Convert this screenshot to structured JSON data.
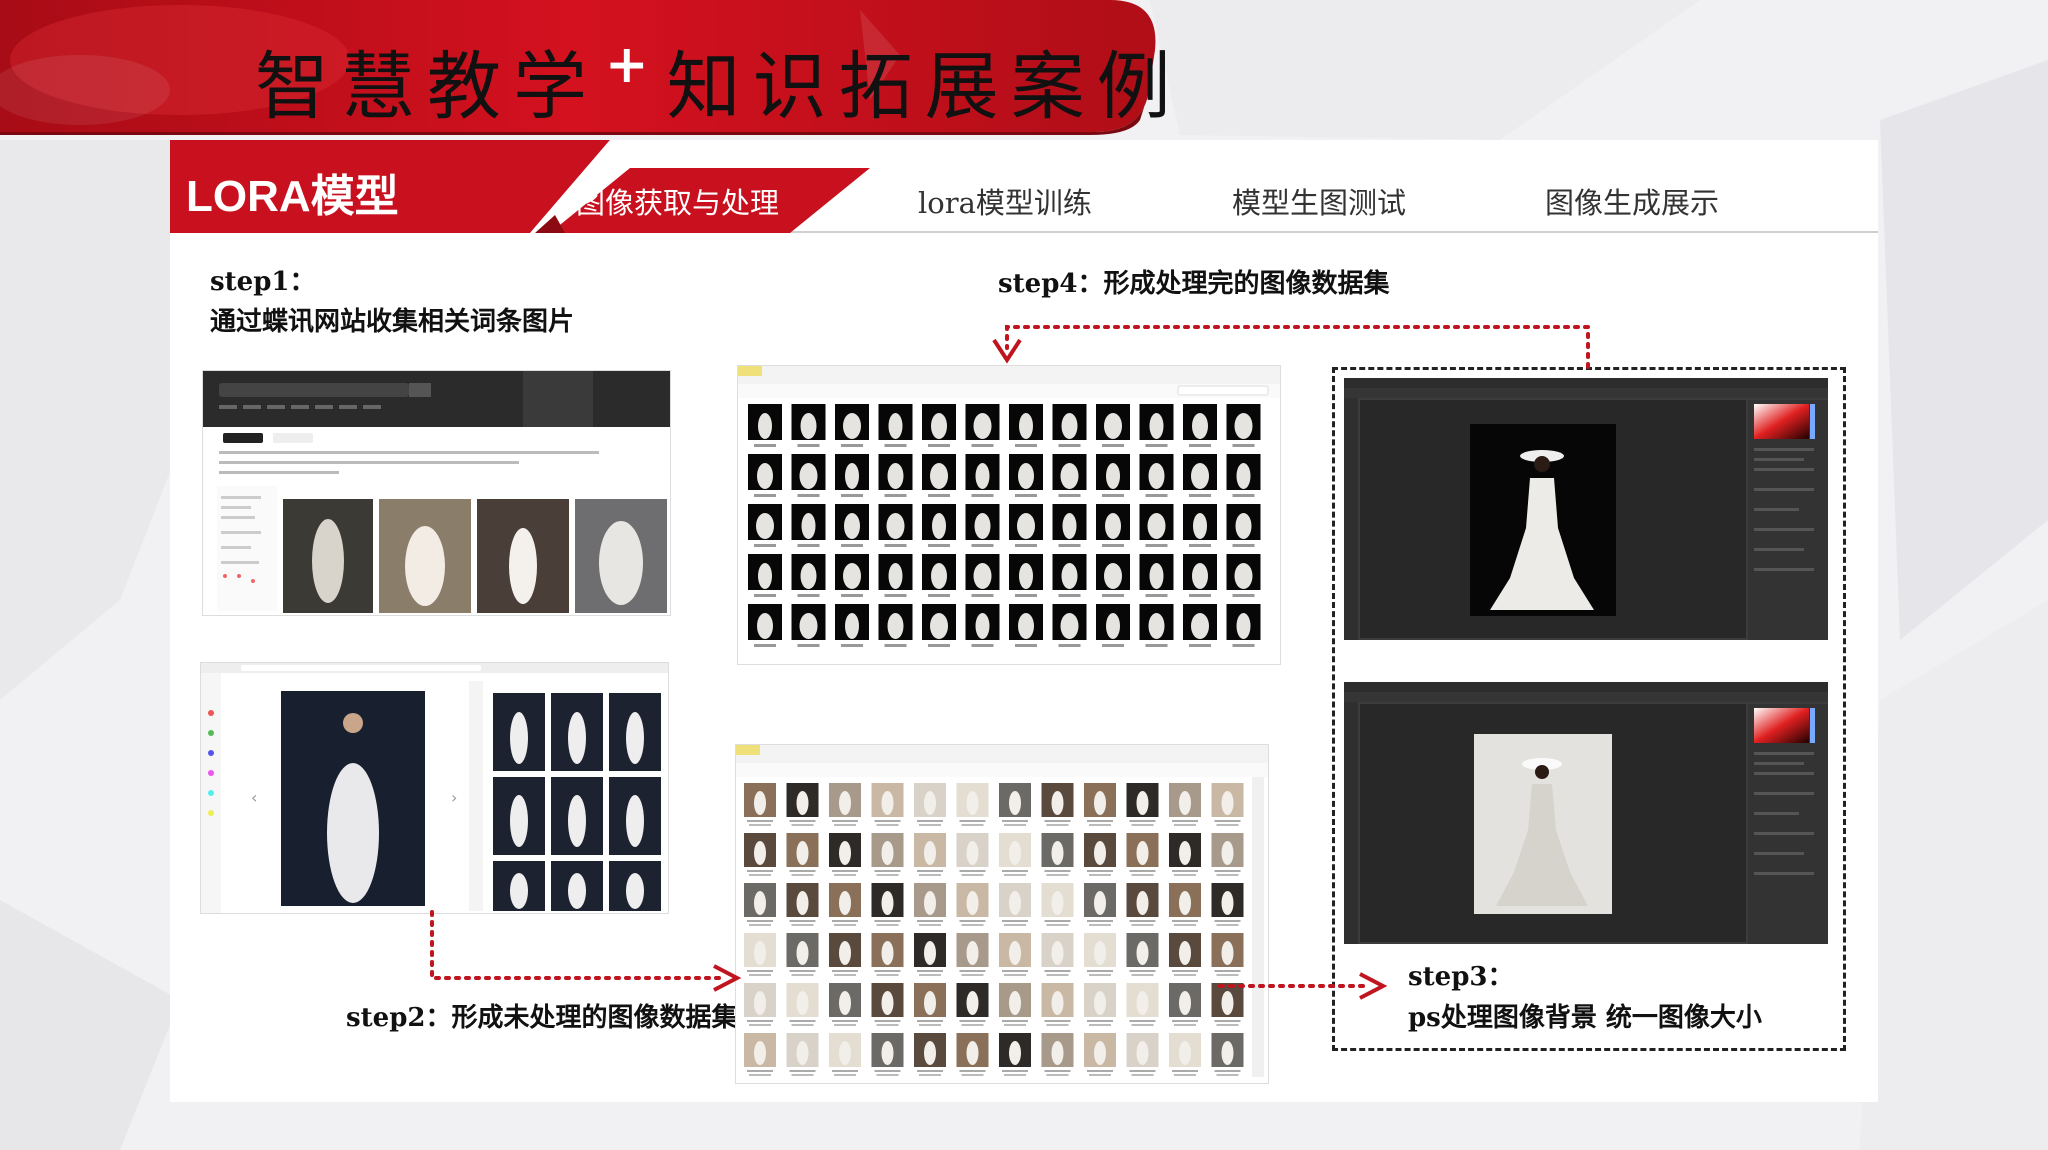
{
  "header": {
    "title_left": "智慧教学",
    "title_plus": "+",
    "title_right": "知识拓展案例"
  },
  "section": {
    "title": "LORA模型",
    "tabs": [
      {
        "label": "图像获取与处理",
        "active": true
      },
      {
        "label": "lora模型训练",
        "active": false
      },
      {
        "label": "模型生图测试",
        "active": false
      },
      {
        "label": "图像生成展示",
        "active": false
      }
    ]
  },
  "steps": {
    "step1_title": "step1：",
    "step1_desc": "通过蝶讯网站收集相关词条图片",
    "step2": "step2：形成未处理的图像数据集",
    "step3_title": "step3：",
    "step3_desc": "ps处理图像背景 统一图像大小",
    "step4": "step4：形成处理完的图像数据集"
  },
  "colors": {
    "accent_red": "#c8101e",
    "dark_red": "#8c0a12",
    "arrow_red": "#c0141e",
    "ps_dark": "#3c3c3c"
  },
  "icons": [
    "plus-icon",
    "arrow-down-icon",
    "arrow-right-icon"
  ]
}
